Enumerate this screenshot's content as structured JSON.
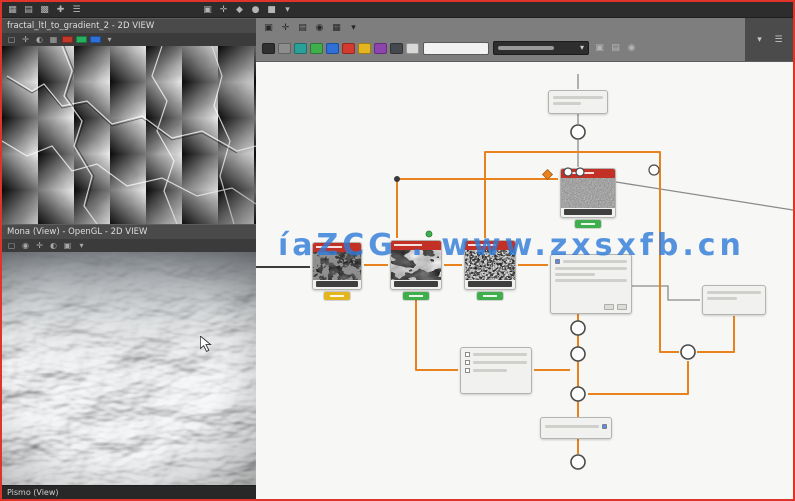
{
  "colors": {
    "frame_red": "#e0342b",
    "wire_orange": "#e8821e",
    "node_header_red": "#c33026",
    "badge_green": "#3fae4c",
    "badge_yellow": "#e3b51f",
    "watermark_blue": "#2f7bd9",
    "canvas_bg": "#f7f7f5"
  },
  "topbar": {
    "left_icons": [
      {
        "name": "menu-grid-icon",
        "glyph": "▦"
      },
      {
        "name": "panels-icon",
        "glyph": "▤"
      },
      {
        "name": "pattern-icon",
        "glyph": "▩"
      },
      {
        "name": "add-icon",
        "glyph": "✚"
      },
      {
        "name": "hamburger-icon",
        "glyph": "☰"
      }
    ],
    "mid_icons": [
      {
        "name": "tool-select-icon",
        "glyph": "▣"
      },
      {
        "name": "tool-move-icon",
        "glyph": "✛"
      },
      {
        "name": "tool-shapes-icon",
        "glyph": "◆"
      },
      {
        "name": "tool-circle-icon",
        "glyph": "●"
      },
      {
        "name": "tool-square-icon",
        "glyph": "■"
      },
      {
        "name": "dropdown-caret-icon",
        "glyph": "▾"
      }
    ]
  },
  "left_panel": {
    "view2d": {
      "title": "fractal_ltl_to_gradient_2 - 2D VIEW",
      "tools": [
        {
          "name": "fit-view-icon",
          "glyph": "▢"
        },
        {
          "name": "pan-icon",
          "glyph": "✛"
        },
        {
          "name": "contrast-icon",
          "glyph": "◐"
        },
        {
          "name": "grid-icon",
          "glyph": "▦"
        },
        {
          "name": "channel-red-icon",
          "color": "#c0392b"
        },
        {
          "name": "channel-green-icon",
          "color": "#27ae60"
        },
        {
          "name": "channel-blue-icon",
          "color": "#2e6fd8"
        },
        {
          "name": "options-caret-icon",
          "glyph": "▾"
        }
      ]
    },
    "view3d": {
      "title": "Mona (View) - OpenGL - 2D VIEW",
      "tools": [
        {
          "name": "fit-view-icon",
          "glyph": "▢"
        },
        {
          "name": "orbit-icon",
          "glyph": "◉"
        },
        {
          "name": "pan-icon",
          "glyph": "✛"
        },
        {
          "name": "lighting-icon",
          "glyph": "◐"
        },
        {
          "name": "material-icon",
          "glyph": "▣"
        },
        {
          "name": "options-caret-icon",
          "glyph": "▾"
        }
      ]
    },
    "status": "Pismo (View)"
  },
  "right": {
    "toolbar_row1": [
      {
        "name": "camera-icon",
        "glyph": "▣"
      },
      {
        "name": "focus-icon",
        "glyph": "✛"
      },
      {
        "name": "layout-icon",
        "glyph": "▤"
      },
      {
        "name": "snapshot-icon",
        "glyph": "◉"
      },
      {
        "name": "grid-icon",
        "glyph": "▦"
      },
      {
        "name": "caret-icon",
        "glyph": "▾"
      }
    ],
    "toolbar_row2": [
      {
        "name": "tool-black-icon",
        "color": "#303030"
      },
      {
        "name": "tool-gray-icon",
        "color": "#8d8d8d"
      },
      {
        "name": "tool-teal-icon",
        "color": "#2aa198"
      },
      {
        "name": "tool-green-icon",
        "color": "#3fae4c"
      },
      {
        "name": "tool-blue-icon",
        "color": "#2e6fd8"
      },
      {
        "name": "tool-red-icon",
        "color": "#d23b2e"
      },
      {
        "name": "tool-yellow-icon",
        "color": "#e3b51f"
      },
      {
        "name": "tool-purple-icon",
        "color": "#8e44ad"
      },
      {
        "name": "tool-dark-icon",
        "color": "#45494d"
      },
      {
        "name": "tool-light-icon",
        "color": "#d8d8d8"
      }
    ],
    "trailing_icons": [
      {
        "name": "filter-icon",
        "glyph": "▣"
      },
      {
        "name": "layers-icon",
        "glyph": "▤"
      },
      {
        "name": "help-icon",
        "glyph": "◉"
      }
    ],
    "corner_icons": [
      {
        "name": "dock-caret-icon",
        "glyph": "▾"
      },
      {
        "name": "panel-menu-icon",
        "glyph": "☰"
      }
    ],
    "dropdown": {
      "caret": "▾"
    }
  },
  "graph": {
    "watermark": "íaZCG . www.zxsxfb.cn",
    "nodes": [
      {
        "id": "node-top",
        "type": "frame"
      },
      {
        "id": "node-noise-a",
        "type": "texture",
        "badge": "green"
      },
      {
        "id": "node-tex-b",
        "type": "texture",
        "badge": "yellow"
      },
      {
        "id": "node-tex-c",
        "type": "texture",
        "badge": "green"
      },
      {
        "id": "node-tex-d",
        "type": "texture",
        "badge": "green"
      },
      {
        "id": "node-params",
        "type": "panel"
      },
      {
        "id": "node-right",
        "type": "panel"
      },
      {
        "id": "node-options",
        "type": "panel"
      },
      {
        "id": "node-small",
        "type": "panel"
      }
    ]
  }
}
